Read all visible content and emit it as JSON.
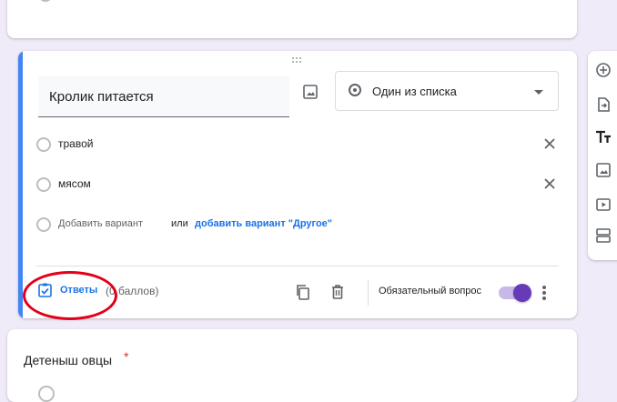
{
  "question": {
    "title": "Кролик питается",
    "type_label": "Один из списка",
    "options": [
      {
        "label": "травой"
      },
      {
        "label": "мясом"
      }
    ],
    "add_option_label": "Добавить вариант",
    "or_label": "или",
    "add_other_label": "добавить вариант \"Другое\"",
    "answers_label": "Ответы",
    "points_label": "(0 баллов)",
    "required_label": "Обязательный вопрос",
    "required": true
  },
  "next_question": {
    "title": "Детеныш овцы",
    "required_marker": "*"
  },
  "toolbar": {
    "icons": [
      "add-question-icon",
      "import-questions-icon",
      "add-title-icon",
      "add-image-icon",
      "add-video-icon",
      "add-section-icon"
    ]
  },
  "colors": {
    "accent_blue": "#4285f4",
    "link_blue": "#1a73e8",
    "toggle_purple": "#673ab7",
    "annotation_red": "#e3001b"
  }
}
